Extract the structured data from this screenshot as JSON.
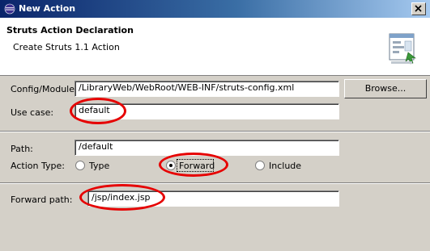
{
  "window": {
    "title": "New Action",
    "icon": "eclipse-icon",
    "close_icon": "close-icon"
  },
  "banner": {
    "title": "Struts Action Declaration",
    "subtitle": "Create Struts 1.1 Action",
    "icon": "wizard-icon"
  },
  "form": {
    "config_label": "Config/Module:",
    "config_value": "/LibraryWeb/WebRoot/WEB-INF/struts-config.xml",
    "browse_label": "Browse...",
    "use_case_label": "Use case:",
    "use_case_value": "default",
    "path_label": "Path:",
    "path_value": "/default",
    "action_type_label": "Action Type:",
    "action_types": [
      "Type",
      "Forward",
      "Include"
    ],
    "selected_action_type": "Forward",
    "forward_path_label": "Forward path:",
    "forward_path_value": "/jsp/index.jsp"
  },
  "colors": {
    "highlight_ovals": "#e60000",
    "titlebar_start": "#0a246a",
    "dialog_bg": "#d4d0c8"
  }
}
